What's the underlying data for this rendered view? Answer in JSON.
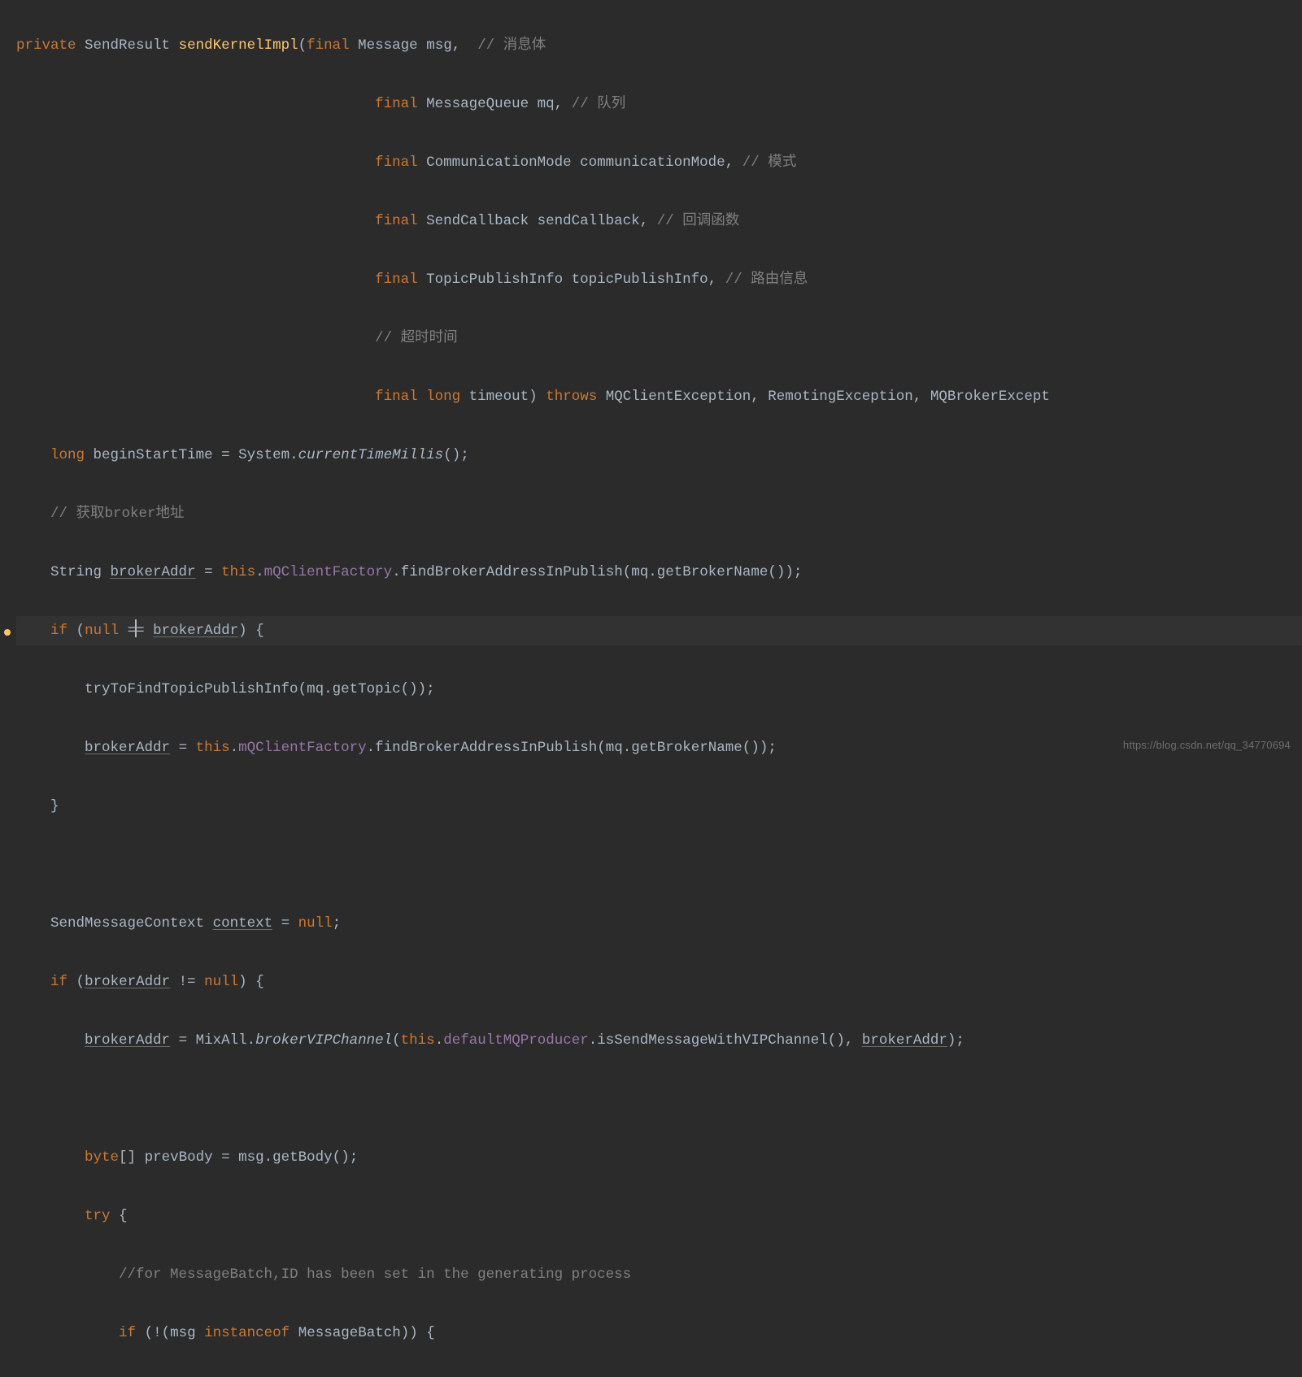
{
  "watermark": "https://blog.csdn.net/qq_34770694",
  "tokens": {
    "kw_private": "private",
    "kw_final": "final",
    "kw_throws": "throws",
    "kw_long": "long",
    "kw_if": "if",
    "kw_null": "null",
    "kw_this": "this",
    "kw_try": "try",
    "kw_byte": "byte",
    "kw_instanceof": "instanceof",
    "type_SendResult": "SendResult",
    "fn_sendKernelImpl": "sendKernelImpl",
    "type_Message": "Message",
    "id_msg": "msg",
    "type_MessageQueue": "MessageQueue",
    "id_mq": "mq",
    "type_CommunicationMode": "CommunicationMode",
    "id_communicationMode": "communicationMode",
    "type_SendCallback": "SendCallback",
    "id_sendCallback": "sendCallback",
    "type_TopicPublishInfo": "TopicPublishInfo",
    "id_topicPublishInfo": "topicPublishInfo",
    "id_timeout": "timeout",
    "type_MQClientException": "MQClientException",
    "type_RemotingException": "RemotingException",
    "type_MQBrokerExcept": "MQBrokerExcept",
    "id_beginStartTime": "beginStartTime",
    "type_System": "System",
    "fn_currentTimeMillis": "currentTimeMillis",
    "type_String": "String",
    "id_brokerAddr": "brokerAddr",
    "field_mQClientFactory": "mQClientFactory",
    "fn_findBrokerAddressInPublish": "findBrokerAddressInPublish",
    "fn_getBrokerName": "getBrokerName",
    "fn_tryToFindTopicPublishInfo": "tryToFindTopicPublishInfo",
    "fn_getTopic": "getTopic",
    "type_SendMessageContext": "SendMessageContext",
    "id_context": "context",
    "type_MixAll": "MixAll",
    "fn_brokerVIPChannel": "brokerVIPChannel",
    "field_defaultMQProducer": "defaultMQProducer",
    "fn_isSendMessageWithVIPChannel": "isSendMessageWithVIPChannel",
    "id_prevBody": "prevBody",
    "fn_getBody": "getBody",
    "type_MessageBatch": "MessageBatch"
  },
  "comments": {
    "c1": "// 消息体",
    "c2": "// 队列",
    "c3": "// 模式",
    "c4": "// 回调函数",
    "c5": "// 路由信息",
    "c6": "// 超时时间",
    "c7": "// 获取broker地址",
    "c8": "//for MessageBatch,ID has been set in the generating process"
  },
  "punct": {
    "lparen": "(",
    "rparen": ")",
    "comma": ",",
    "semi": ";",
    "lbrace": "{",
    "rbrace": "}",
    "eq": "=",
    "eqeq": "==",
    "neq": "!=",
    "dot": ".",
    "brackets": "[]",
    "not": "!"
  },
  "indent": {
    "p0": "",
    "p1": "    ",
    "p2": "        ",
    "p3": "            ",
    "sig": "                                          "
  }
}
